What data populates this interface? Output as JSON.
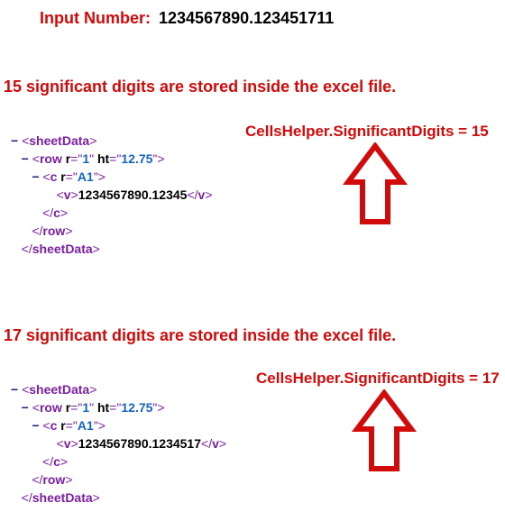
{
  "input": {
    "label": "Input Number:",
    "value": "1234567890.123451711"
  },
  "sections": [
    {
      "heading": "15 significant digits are stored inside the excel file.",
      "annotation": "CellsHelper.SignificantDigits = 15",
      "xml": {
        "row_r": "1",
        "row_ht": "12.75",
        "cell_r": "A1",
        "stored_value": "1234567890.12345"
      }
    },
    {
      "heading": "17 significant digits are stored inside the excel file.",
      "annotation": "CellsHelper.SignificantDigits = 17",
      "xml": {
        "row_r": "1",
        "row_ht": "12.75",
        "cell_r": "A1",
        "stored_value": "1234567890.1234517"
      }
    }
  ]
}
